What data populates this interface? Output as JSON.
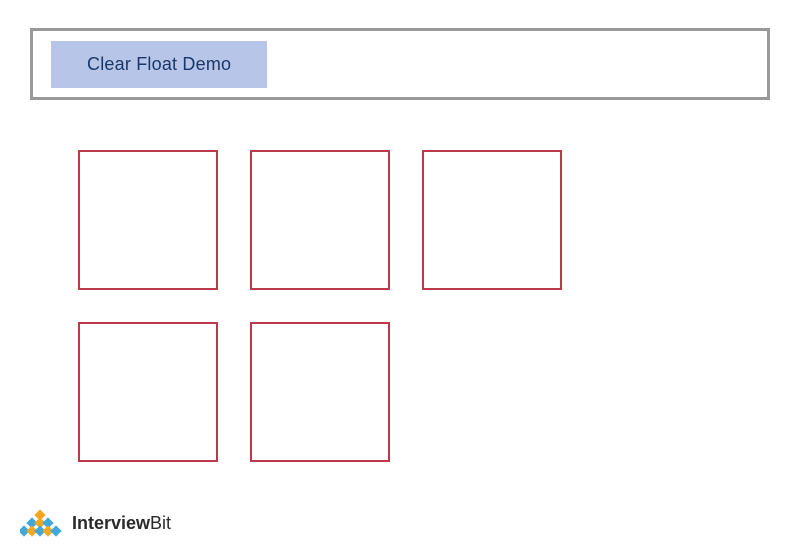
{
  "header": {
    "title": "Clear Float Demo"
  },
  "brand": {
    "name_bold": "Interview",
    "name_light": "Bit"
  },
  "colors": {
    "header_border": "#999999",
    "chip_bg": "#b7c6e8",
    "chip_text": "#1a3768",
    "box_border": "#bb3a4a",
    "logo_blue": "#3fa9db",
    "logo_orange": "#f5a623"
  },
  "boxes": {
    "rows": [
      3,
      2
    ]
  }
}
